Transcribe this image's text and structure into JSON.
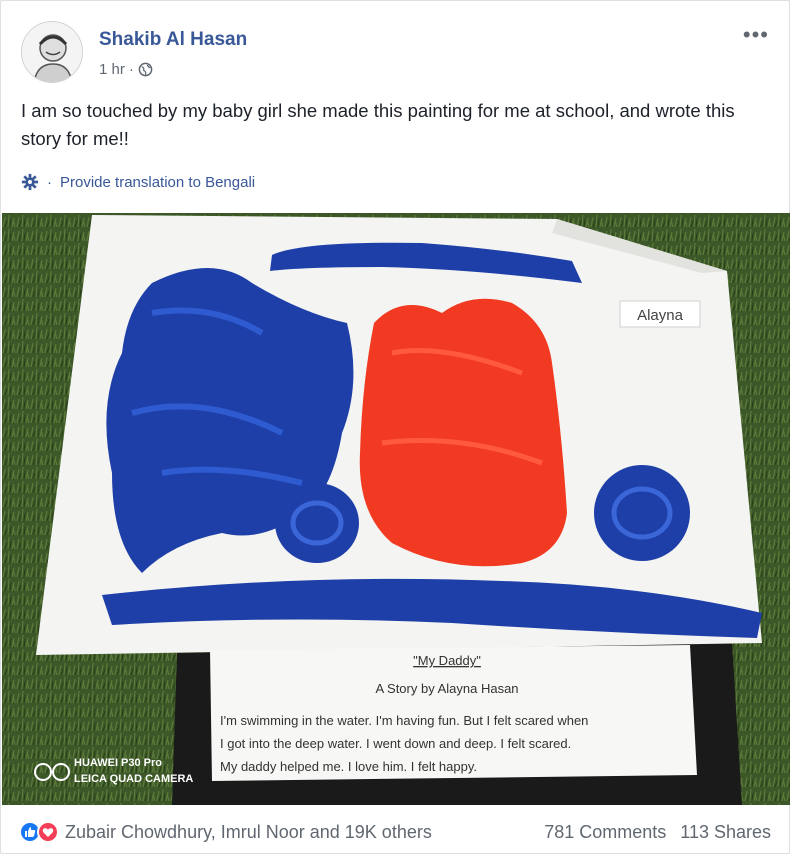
{
  "post": {
    "author": "Shakib Al Hasan",
    "time": "1 hr",
    "time_separator": "·",
    "more_label": "•••",
    "message": "I am so touched by my baby girl she made this painting for me at school, and wrote this story for me!!",
    "translation_separator": "·",
    "translation_link": "Provide translation to Bengali"
  },
  "photo": {
    "name_tag": "Alayna",
    "story_title": "\"My Daddy\"",
    "story_byline": "A Story by Alayna Hasan",
    "story_lines": [
      "I'm swimming in the water.  I'm having fun.  But I felt scared when",
      "I got into the deep water.  I went down and deep.  I felt scared.",
      "My daddy helped me.  I love him.  I felt happy."
    ],
    "watermark_line1": "HUAWEI P30 Pro",
    "watermark_line2": "LEICA QUAD CAMERA",
    "colors": {
      "paint_blue": "#1e3fa8",
      "paint_red": "#f23a22",
      "grass": "#3f5a2a",
      "paper": "#f4f4f2"
    }
  },
  "footer": {
    "reactors": "Zubair Chowdhury, Imrul Noor and 19K others",
    "comments": "781 Comments",
    "shares": "113 Shares"
  },
  "colors": {
    "link": "#385898",
    "secondary": "#606770",
    "like": "#1877f2",
    "love": "#f33e58"
  }
}
